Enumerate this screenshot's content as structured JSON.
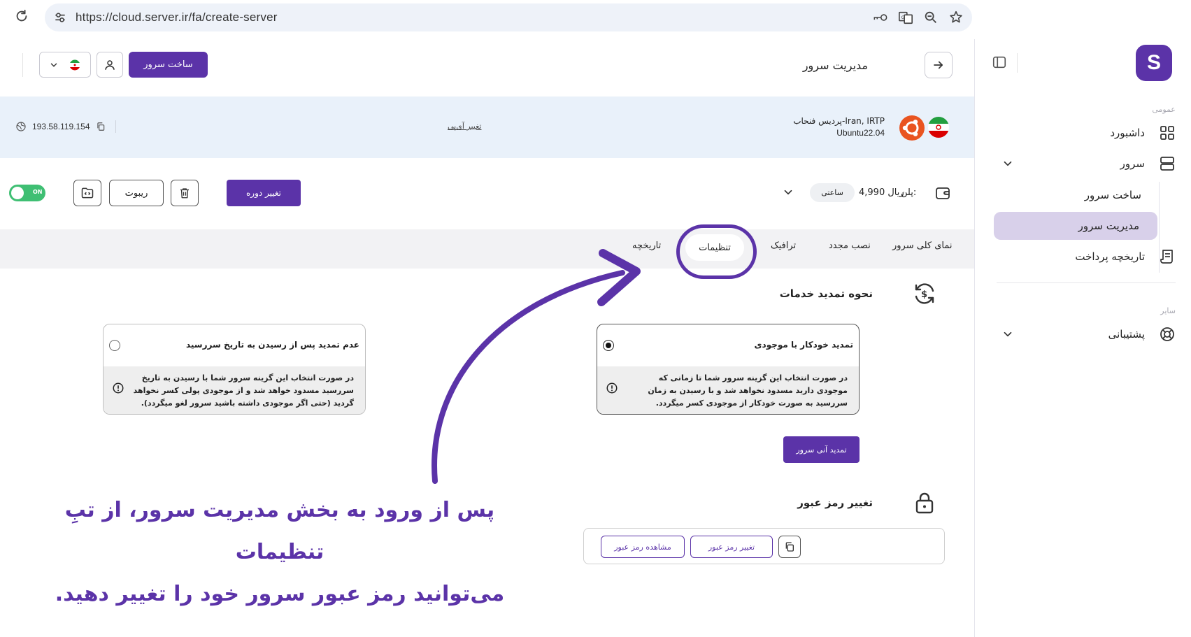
{
  "browser": {
    "url": "https://cloud.server.ir/fa/create-server"
  },
  "header": {
    "page_title": "مدیریت سرور",
    "create_server_label": "ساخت سرور"
  },
  "sidebar": {
    "logo_letter": "S",
    "section_general": "عمومی",
    "section_other": "سایر",
    "dashboard": "داشبورد",
    "server": "سرور",
    "create_server": "ساخت سرور",
    "manage_server": "مدیریت سرور",
    "payment_history": "تاریخچه پرداخت",
    "support": "پشتیبانی"
  },
  "server_info": {
    "location": "Iran, IRTP-پردیس فنحاب",
    "os": "Ubuntu22.04",
    "change_ip_label": "تغییر آی‌پی",
    "ip": "193.58.119.154"
  },
  "plan": {
    "label": "پلن:",
    "price": "ریال 4,990",
    "billing": "ساعتی",
    "change_period_label": "تغییر دوره",
    "reboot_label": "ریبوت",
    "power_state": "ON"
  },
  "tabs": {
    "overview": "نمای کلی سرور",
    "reinstall": "نصب مجدد",
    "traffic": "ترافیک",
    "settings": "تنظیمات",
    "history": "تاریخچه"
  },
  "renewal": {
    "title": "نحوه تمدید خدمات",
    "auto_title": "تمدید خودکار با موجودی",
    "auto_desc": "در صورت انتخاب این گزینه سرور شما تا زمانی که موجودی دارید مسدود نخواهد شد و با رسیدن به زمان سررسید به صورت خودکار از موجودی کسر میگردد.",
    "no_renew_title": "عدم تمدید پس از رسیدن به تاریخ سررسید",
    "no_renew_desc": "در صورت انتخاب این گزینه سرور شما با رسیدن به تاریخ سررسید مسدود خواهد شد و از موجودی پولی کسر نخواهد گردید (حتی اگر موجودی داشته باشید سرور لغو میگردد).",
    "renew_now_label": "تمدید آنی سرور"
  },
  "password": {
    "title": "تغییر رمز عبور",
    "change_label": "تغییر رمز عبور",
    "show_label": "مشاهده رمز عبور"
  },
  "annotation": {
    "line1": "پس از ورود به بخش مدیریت سرور، از تبِ تنظیمات",
    "line2": "می‌توانید رمز عبور سرور خود را تغییر دهید."
  },
  "colors": {
    "brand": "#5b33a8",
    "active_nav": "#d8d0ea",
    "server_info_bg": "#e9f1fa",
    "toggle_on": "#3fbf73"
  }
}
